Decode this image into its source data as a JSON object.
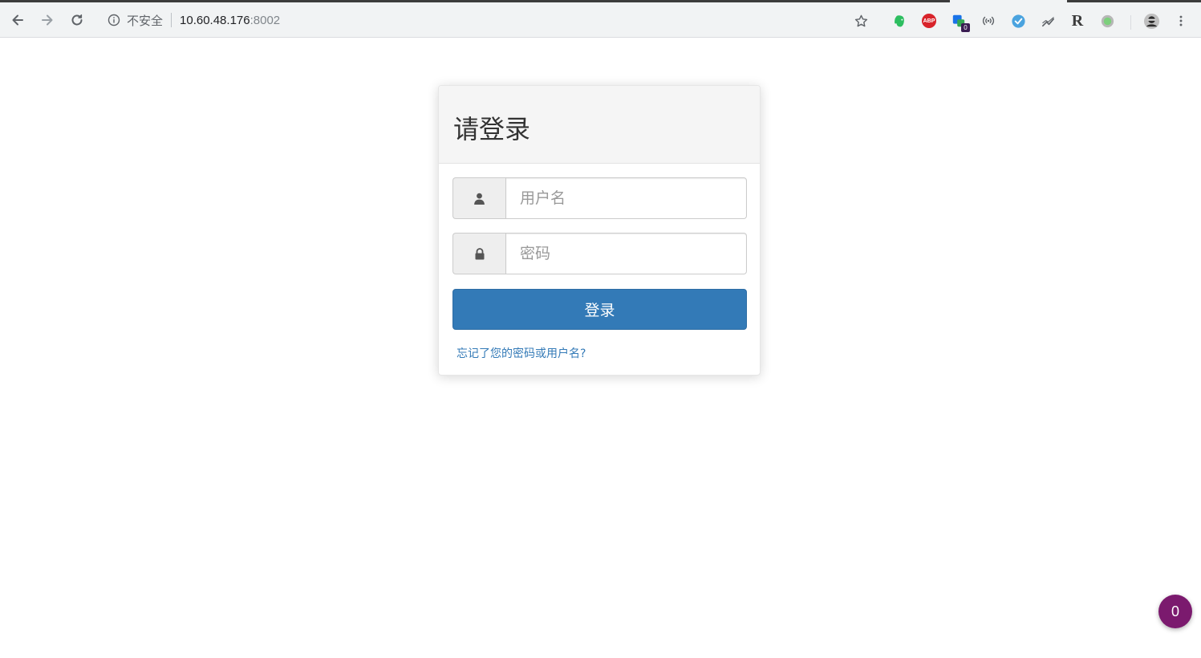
{
  "browser": {
    "security_label": "不安全",
    "url_host": "10.60.48.176",
    "url_port": ":8002",
    "extensions": [
      "evernote-icon",
      "adblock-plus-icon",
      "translate-extension-icon",
      "broadcast-extension-icon",
      "blue-check-extension-icon",
      "chart-extension-icon",
      "r-extension-icon",
      "green-circle-extension-icon"
    ],
    "extension_badge": "0",
    "adblock_label": "ABP",
    "r_label": "R"
  },
  "login": {
    "title": "请登录",
    "username_placeholder": "用户名",
    "password_placeholder": "密码",
    "submit_label": "登录",
    "forgot_link": "忘记了您的密码或用户名?"
  },
  "floating_badge": {
    "count": "0"
  },
  "colors": {
    "primary": "#337ab7",
    "badge": "#7b1a6e",
    "heading_bg": "#f5f5f5"
  }
}
